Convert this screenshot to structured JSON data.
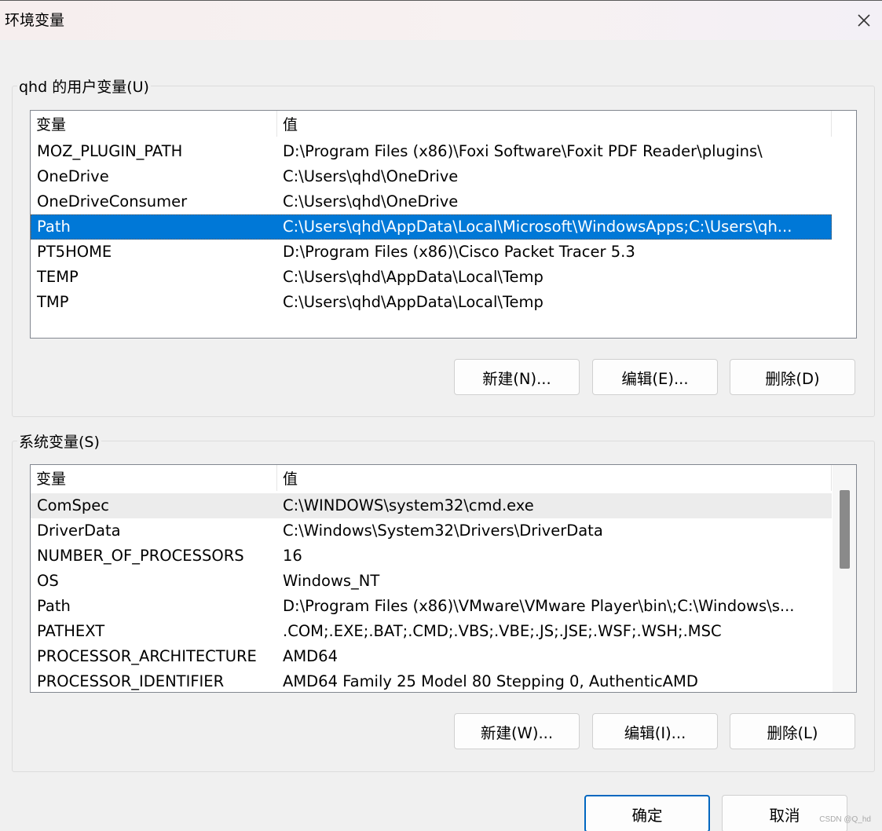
{
  "window": {
    "title": "环境变量",
    "close_icon": "close-icon"
  },
  "user_vars": {
    "legend": "qhd 的用户变量(U)",
    "headers": [
      "变量",
      "值"
    ],
    "rows": [
      {
        "name": "MOZ_PLUGIN_PATH",
        "value": "D:\\Program Files (x86)\\Foxi Software\\Foxit PDF Reader\\plugins\\"
      },
      {
        "name": "OneDrive",
        "value": "C:\\Users\\qhd\\OneDrive"
      },
      {
        "name": "OneDriveConsumer",
        "value": "C:\\Users\\qhd\\OneDrive"
      },
      {
        "name": "Path",
        "value": "C:\\Users\\qhd\\AppData\\Local\\Microsoft\\WindowsApps;C:\\Users\\qh..."
      },
      {
        "name": "PT5HOME",
        "value": "D:\\Program Files (x86)\\Cisco Packet Tracer 5.3"
      },
      {
        "name": "TEMP",
        "value": "C:\\Users\\qhd\\AppData\\Local\\Temp"
      },
      {
        "name": "TMP",
        "value": "C:\\Users\\qhd\\AppData\\Local\\Temp"
      }
    ],
    "selected_row": "Path",
    "buttons": {
      "new": "新建(N)...",
      "edit": "编辑(E)...",
      "delete": "删除(D)"
    }
  },
  "system_vars": {
    "legend": "系统变量(S)",
    "headers": [
      "变量",
      "值"
    ],
    "rows": [
      {
        "name": "ComSpec",
        "value": "C:\\WINDOWS\\system32\\cmd.exe"
      },
      {
        "name": "DriverData",
        "value": "C:\\Windows\\System32\\Drivers\\DriverData"
      },
      {
        "name": "NUMBER_OF_PROCESSORS",
        "value": "16"
      },
      {
        "name": "OS",
        "value": "Windows_NT"
      },
      {
        "name": "Path",
        "value": "D:\\Program Files (x86)\\VMware\\VMware Player\\bin\\;C:\\Windows\\s..."
      },
      {
        "name": "PATHEXT",
        "value": ".COM;.EXE;.BAT;.CMD;.VBS;.VBE;.JS;.JSE;.WSF;.WSH;.MSC"
      },
      {
        "name": "PROCESSOR_ARCHITECTURE",
        "value": "AMD64"
      },
      {
        "name": "PROCESSOR_IDENTIFIER",
        "value": "AMD64 Family 25 Model 80 Stepping 0, AuthenticAMD"
      }
    ],
    "hovered_row": "ComSpec",
    "scroll_position": 0.1,
    "buttons": {
      "new": "新建(W)...",
      "edit": "编辑(I)...",
      "delete": "删除(L)"
    }
  },
  "footer": {
    "ok": "确定",
    "cancel": "取消"
  },
  "watermark": "CSDN @Q_hd",
  "colors": {
    "selection": "#0078d7",
    "primary_border": "#0067c0",
    "dialog_bg": "#f0f0f0"
  }
}
